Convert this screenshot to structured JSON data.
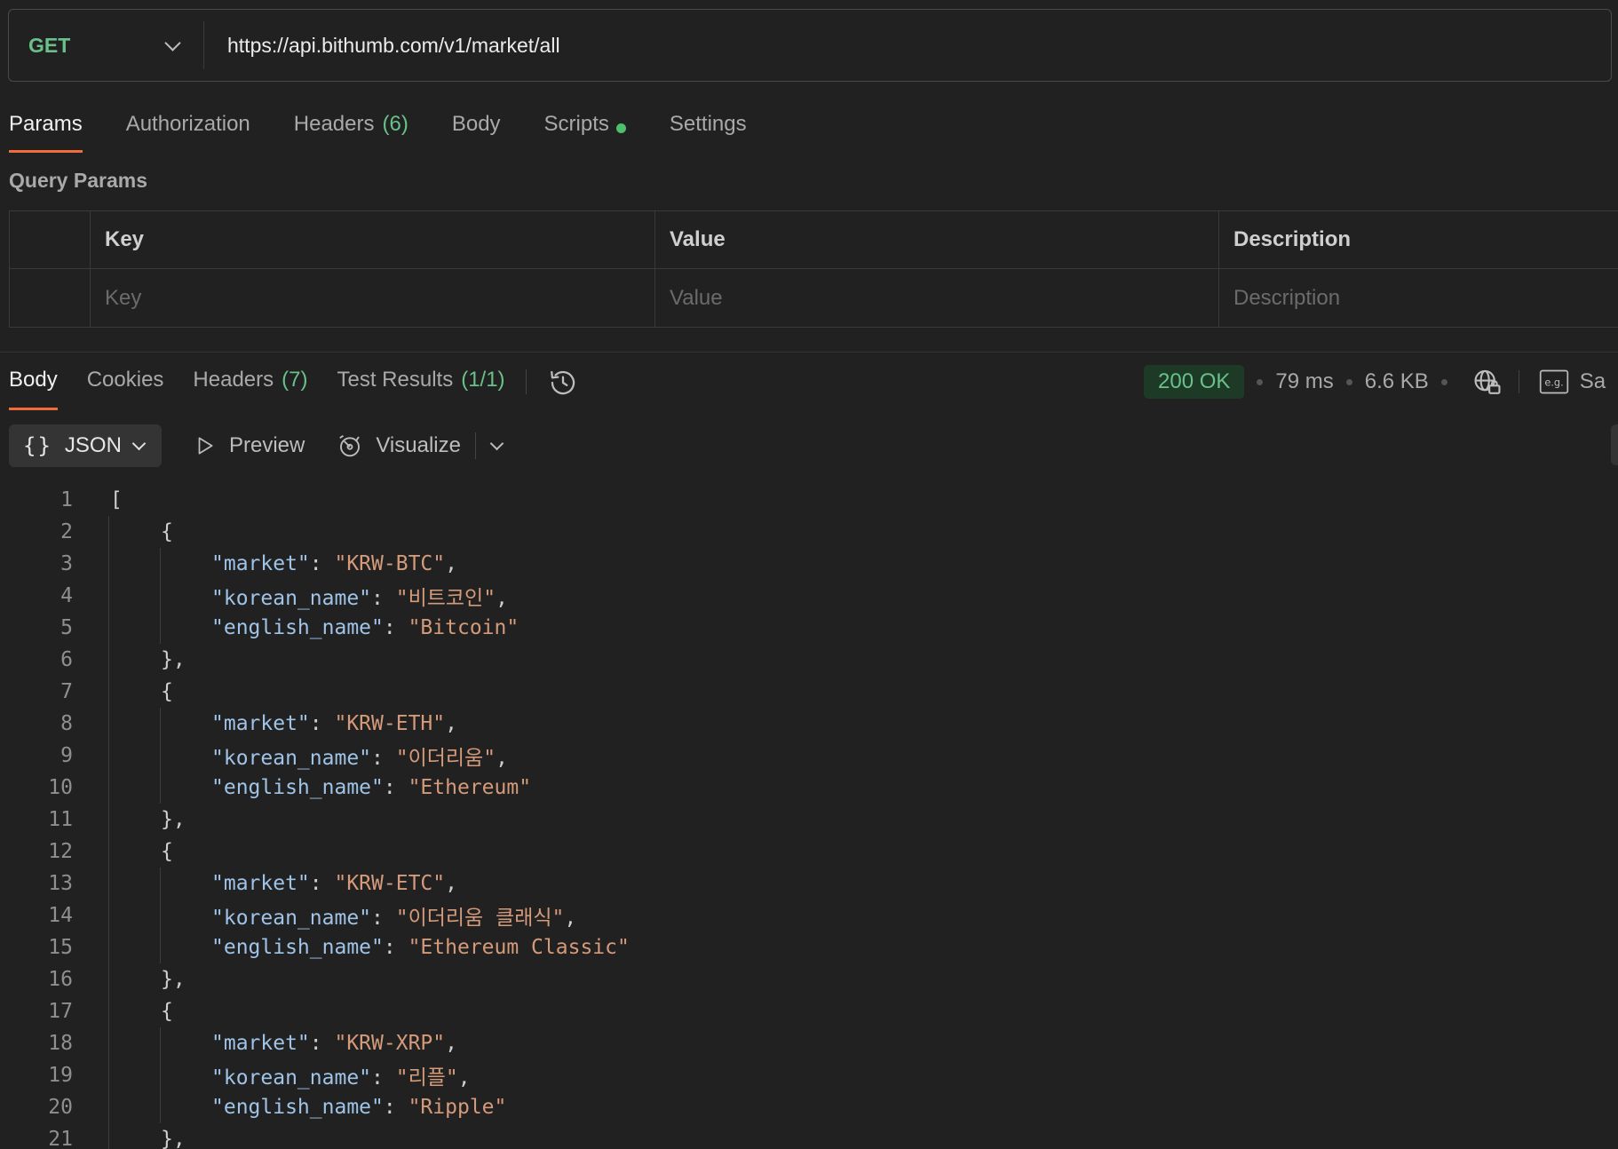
{
  "request": {
    "method": "GET",
    "url": "https://api.bithumb.com/v1/market/all"
  },
  "request_tabs": [
    {
      "label": "Params",
      "count": ""
    },
    {
      "label": "Authorization",
      "count": ""
    },
    {
      "label": "Headers",
      "count": "(6)"
    },
    {
      "label": "Body",
      "count": ""
    },
    {
      "label": "Scripts",
      "count": ""
    },
    {
      "label": "Settings",
      "count": ""
    }
  ],
  "query_params": {
    "title": "Query Params",
    "headers": [
      "Key",
      "Value",
      "Description"
    ],
    "placeholders": [
      "Key",
      "Value",
      "Description"
    ]
  },
  "response_tabs": [
    {
      "label": "Body",
      "count": ""
    },
    {
      "label": "Cookies",
      "count": ""
    },
    {
      "label": "Headers",
      "count": "(7)"
    },
    {
      "label": "Test Results",
      "count": "(1/1)"
    }
  ],
  "response_meta": {
    "status": "200 OK",
    "time": "79 ms",
    "size": "6.6 KB",
    "save_label": "Sa"
  },
  "body_toolbar": {
    "format": "JSON",
    "preview": "Preview",
    "visualize": "Visualize"
  },
  "code_lines": [
    {
      "n": "1",
      "text": "["
    },
    {
      "n": "2",
      "text": "{"
    },
    {
      "n": "3",
      "key": "\"market\"",
      "value": "\"KRW-BTC\"",
      "trail": ","
    },
    {
      "n": "4",
      "key": "\"korean_name\"",
      "value": "\"비트코인\"",
      "trail": ","
    },
    {
      "n": "5",
      "key": "\"english_name\"",
      "value": "\"Bitcoin\"",
      "trail": ""
    },
    {
      "n": "6",
      "text": "},"
    },
    {
      "n": "7",
      "text": "{"
    },
    {
      "n": "8",
      "key": "\"market\"",
      "value": "\"KRW-ETH\"",
      "trail": ","
    },
    {
      "n": "9",
      "key": "\"korean_name\"",
      "value": "\"이더리움\"",
      "trail": ","
    },
    {
      "n": "10",
      "key": "\"english_name\"",
      "value": "\"Ethereum\"",
      "trail": ""
    },
    {
      "n": "11",
      "text": "},"
    },
    {
      "n": "12",
      "text": "{"
    },
    {
      "n": "13",
      "key": "\"market\"",
      "value": "\"KRW-ETC\"",
      "trail": ","
    },
    {
      "n": "14",
      "key": "\"korean_name\"",
      "value": "\"이더리움 클래식\"",
      "trail": ","
    },
    {
      "n": "15",
      "key": "\"english_name\"",
      "value": "\"Ethereum Classic\"",
      "trail": ""
    },
    {
      "n": "16",
      "text": "},"
    },
    {
      "n": "17",
      "text": "{"
    },
    {
      "n": "18",
      "key": "\"market\"",
      "value": "\"KRW-XRP\"",
      "trail": ","
    },
    {
      "n": "19",
      "key": "\"korean_name\"",
      "value": "\"리플\"",
      "trail": ","
    },
    {
      "n": "20",
      "key": "\"english_name\"",
      "value": "\"Ripple\"",
      "trail": ""
    },
    {
      "n": "21",
      "text": "},"
    }
  ]
}
